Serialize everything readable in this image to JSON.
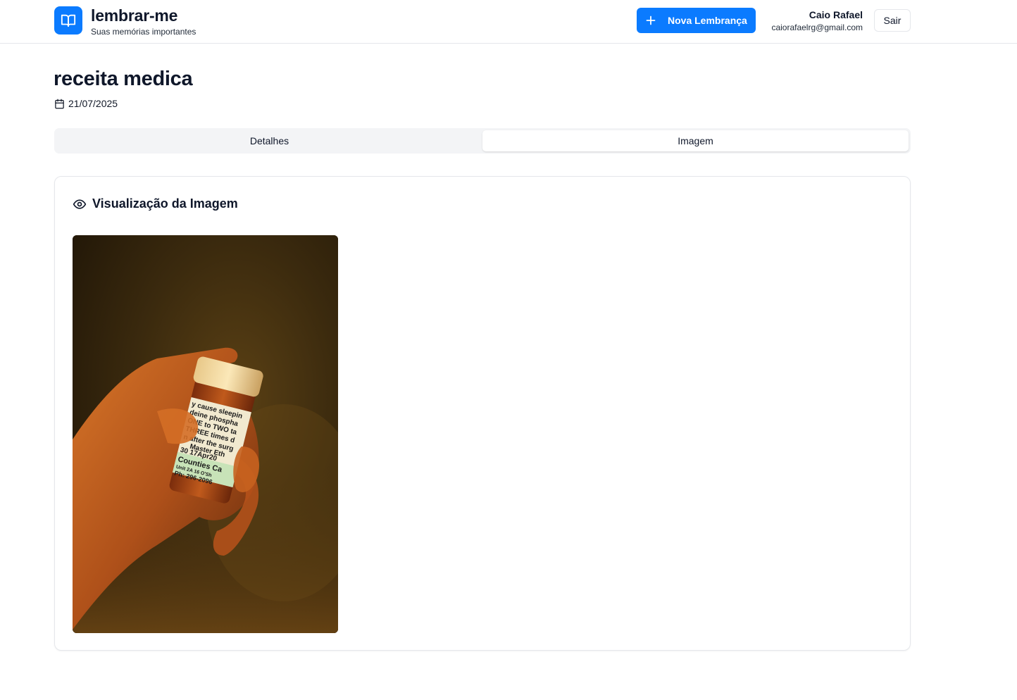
{
  "header": {
    "app_title": "lembrar-me",
    "app_subtitle": "Suas memórias importantes",
    "logo_icon": "book-open-icon",
    "new_button_label": "Nova Lembrança",
    "user_name": "Caio Rafael",
    "user_email": "caiorafaelrg@gmail.com",
    "logout_label": "Sair"
  },
  "page": {
    "title": "receita medica",
    "date": "21/07/2025",
    "date_icon": "calendar-icon"
  },
  "tabs": [
    {
      "label": "Detalhes",
      "active": false
    },
    {
      "label": "Imagem",
      "active": true
    }
  ],
  "image_panel": {
    "title": "Visualização da Imagem",
    "icon": "eye-icon",
    "photo_label_lines": [
      "y cause sleepin",
      "deine phospha",
      "ONE to TWO ta",
      "THREE times d",
      "n after the surg",
      "Master Eth",
      "30 17Apr20",
      "Counties Ca",
      "Unit 2A 16 O'Sh",
      "Ph: 296-2096"
    ]
  },
  "colors": {
    "accent": "#0b7bff",
    "border": "#e5e7eb",
    "tabs_background": "#f3f4f6"
  }
}
